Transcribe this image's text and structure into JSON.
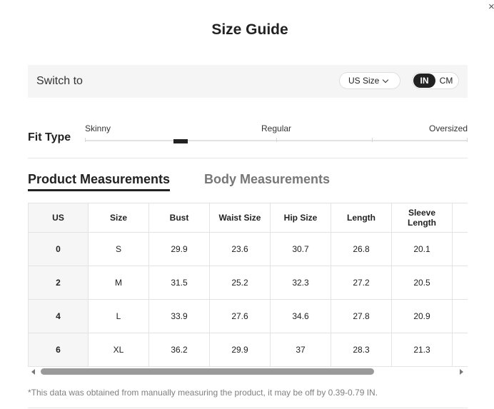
{
  "dialog": {
    "close_icon": "×"
  },
  "title": "Size Guide",
  "switch": {
    "label": "Switch to",
    "size_system": "US Size",
    "units": {
      "active": "IN",
      "inactive": "CM"
    }
  },
  "fit_type": {
    "label": "Fit Type",
    "scale": [
      "Skinny",
      "Regular",
      "Oversized"
    ],
    "marker_position": 0.25
  },
  "tabs": {
    "active": "Product Measurements",
    "inactive": "Body Measurements"
  },
  "table": {
    "columns": [
      "US",
      "Size",
      "Bust",
      "Waist Size",
      "Hip Size",
      "Length",
      "Sleeve Length"
    ],
    "rows": [
      [
        "0",
        "S",
        "29.9",
        "23.6",
        "30.7",
        "26.8",
        "20.1"
      ],
      [
        "2",
        "M",
        "31.5",
        "25.2",
        "32.3",
        "27.2",
        "20.5"
      ],
      [
        "4",
        "L",
        "33.9",
        "27.6",
        "34.6",
        "27.8",
        "20.9"
      ],
      [
        "6",
        "XL",
        "36.2",
        "29.9",
        "37",
        "28.3",
        "21.3"
      ]
    ]
  },
  "footnote": "*This data was obtained from manually measuring the product, it may be off by 0.39-0.79 IN.",
  "colors": {
    "accent": "#222222",
    "muted_tab": "#777777",
    "bar_bg": "#f5f5f5",
    "us_column_bg": "#f6f6f6"
  }
}
